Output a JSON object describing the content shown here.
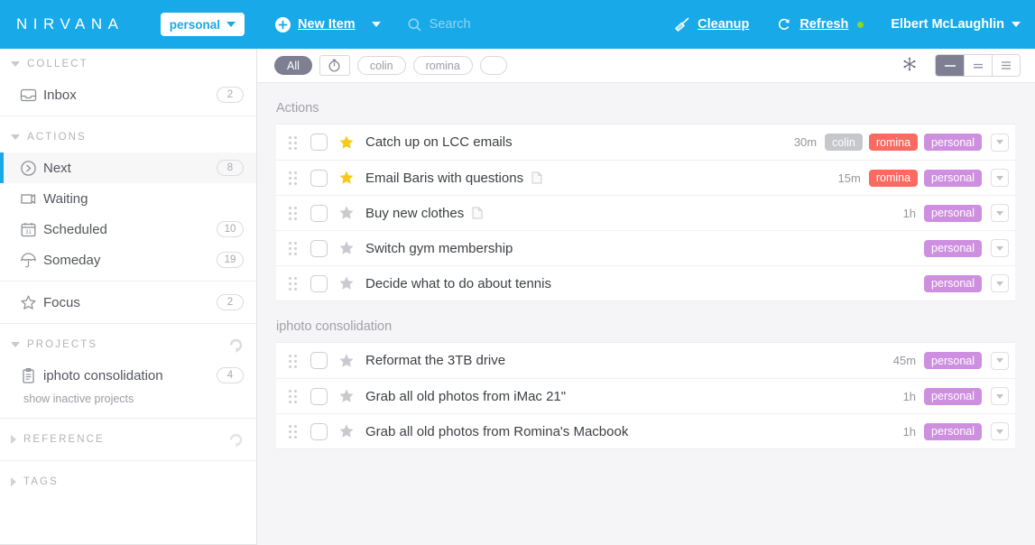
{
  "header": {
    "logo": "NIRVANA",
    "workspace": "personal",
    "new_item": "New Item",
    "search_placeholder": "Search",
    "cleanup": "Cleanup",
    "refresh": "Refresh",
    "user": "Elbert McLaughlin"
  },
  "sidebar": {
    "sections": [
      {
        "label": "COLLECT",
        "expanded": true,
        "has_refresh": false,
        "items": [
          {
            "label": "Inbox",
            "icon": "inbox-icon",
            "badge": "2",
            "active": false
          }
        ]
      },
      {
        "label": "ACTIONS",
        "expanded": true,
        "has_refresh": false,
        "items": [
          {
            "label": "Next",
            "icon": "next-icon",
            "badge": "8",
            "active": true
          },
          {
            "label": "Waiting",
            "icon": "waiting-icon",
            "badge": "",
            "active": false
          },
          {
            "label": "Scheduled",
            "icon": "calendar-icon",
            "badge": "10",
            "active": false
          },
          {
            "label": "Someday",
            "icon": "umbrella-icon",
            "badge": "19",
            "active": false
          }
        ]
      },
      {
        "label": "",
        "expanded": true,
        "has_refresh": false,
        "items": [
          {
            "label": "Focus",
            "icon": "star-icon",
            "badge": "2",
            "active": false
          }
        ]
      },
      {
        "label": "PROJECTS",
        "expanded": true,
        "has_refresh": true,
        "items": [
          {
            "label": "iphoto consolidation",
            "icon": "clipboard-icon",
            "badge": "4",
            "active": false
          }
        ],
        "sublink": "show inactive projects"
      },
      {
        "label": "REFERENCE",
        "expanded": false,
        "has_refresh": true,
        "items": []
      },
      {
        "label": "TAGS",
        "expanded": false,
        "has_refresh": false,
        "items": []
      }
    ]
  },
  "filterbar": {
    "all_label": "All",
    "timer_icon": "stopwatch-icon",
    "tag_filters": [
      "colin",
      "romina"
    ],
    "empty_filter": "",
    "snowflake_icon": "snowflake-icon",
    "views": [
      "view-compact",
      "view-medium",
      "view-detailed"
    ],
    "active_view": 0
  },
  "tag_colors": {
    "colin": "#c6c6cd",
    "romina": "#fa6a60",
    "personal": "#cf8fe0"
  },
  "groups": [
    {
      "title": "Actions",
      "rows": [
        {
          "title": "Catch up on LCC emails",
          "starred": true,
          "note": false,
          "duration": "30m",
          "tags": [
            "colin",
            "romina",
            "personal"
          ]
        },
        {
          "title": "Email Baris with questions",
          "starred": true,
          "note": true,
          "duration": "15m",
          "tags": [
            "romina",
            "personal"
          ]
        },
        {
          "title": "Buy new clothes",
          "starred": false,
          "note": true,
          "duration": "1h",
          "tags": [
            "personal"
          ]
        },
        {
          "title": "Switch gym membership",
          "starred": false,
          "note": false,
          "duration": "",
          "tags": [
            "personal"
          ]
        },
        {
          "title": "Decide what to do about tennis",
          "starred": false,
          "note": false,
          "duration": "",
          "tags": [
            "personal"
          ]
        }
      ]
    },
    {
      "title": "iphoto consolidation",
      "rows": [
        {
          "title": "Reformat the 3TB drive",
          "starred": false,
          "note": false,
          "duration": "45m",
          "tags": [
            "personal"
          ]
        },
        {
          "title": "Grab all old photos from iMac 21\"",
          "starred": false,
          "note": false,
          "duration": "1h",
          "tags": [
            "personal"
          ]
        },
        {
          "title": "Grab all old photos from Romina's Macbook",
          "starred": false,
          "note": false,
          "duration": "1h",
          "tags": [
            "personal"
          ]
        }
      ]
    }
  ],
  "colors": {
    "brand": "#17a9e8",
    "star_active": "#f7ca18",
    "star_inactive": "#c9c9cf",
    "accent_bar": "#17a9e8"
  }
}
